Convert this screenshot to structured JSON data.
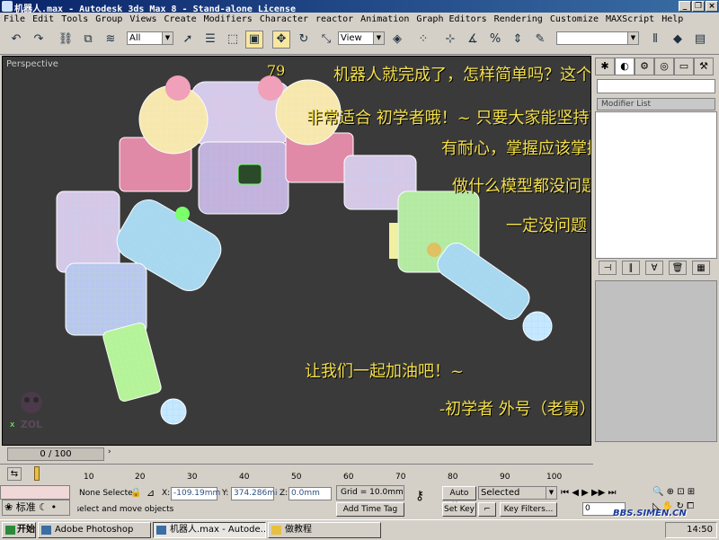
{
  "window": {
    "title": "机器人.max - Autodesk 3ds Max 8  - Stand-alone License",
    "controls": [
      "_",
      "❐",
      "×"
    ]
  },
  "menu": [
    "File",
    "Edit",
    "Tools",
    "Group",
    "Views",
    "Create",
    "Modifiers",
    "Character",
    "reactor",
    "Animation",
    "Graph Editors",
    "Rendering",
    "Customize",
    "MAXScript",
    "Help"
  ],
  "toolbar": {
    "selection_filter": "All",
    "ref_coord": "View",
    "named_selection": ""
  },
  "viewport": {
    "label": "Perspective",
    "overlay_text": [
      "79",
      "机器人就完成了，怎样简单吗？这个模型",
      "非常适合 初学者哦！~ 只要大家能坚持下来",
      "有耐心，掌握应该掌握的命令",
      "做什么模型都没问题！~",
      "一定没问题",
      "让我们一起加油吧！~",
      "-初学者   外号（老舅）"
    ],
    "watermark": "ZOL",
    "axis_x": "x",
    "colors": {
      "background": "#3a3a3a",
      "overlay_text": "#f4e04a"
    }
  },
  "command_panel": {
    "modifier_list": "Modifier List"
  },
  "timeline": {
    "frame_display": "0 / 100",
    "ticks": [
      "10",
      "20",
      "30",
      "40",
      "50",
      "60",
      "70",
      "80",
      "90",
      "100"
    ]
  },
  "status": {
    "selection": "None Selecte",
    "prompt": "Click and drag to select and move objects",
    "x_label": "X:",
    "x_value": "-109.19mm",
    "y_label": "Y:",
    "y_value": "374.286mi",
    "z_label": "Z:",
    "z_value": "0.0mm",
    "grid": "Grid = 10.0mm",
    "add_time_tag": "Add Time Tag",
    "auto_key": "Auto Key",
    "set_key": "Set Key",
    "key_mode": "Selected",
    "key_filters": "Key Filters...",
    "current_frame": "0"
  },
  "taskbar": {
    "start": "开始",
    "tasks": [
      "Adobe Photoshop",
      "机器人.max - Autode...",
      "做教程"
    ],
    "ime": "标准",
    "clock": "14:50",
    "site_watermark": "BBS.SIMEN.CN"
  }
}
